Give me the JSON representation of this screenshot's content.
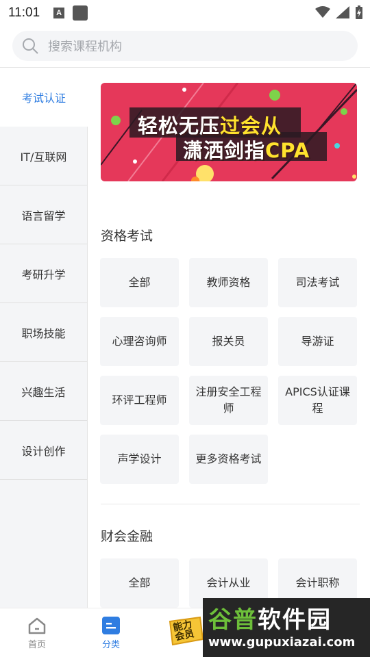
{
  "status_bar": {
    "time": "11:01",
    "notif_letter": "A"
  },
  "search": {
    "placeholder": "搜索课程机构"
  },
  "sidebar": {
    "items": [
      {
        "label": "考试认证",
        "active": true
      },
      {
        "label": "IT/互联网",
        "active": false
      },
      {
        "label": "语言留学",
        "active": false
      },
      {
        "label": "考研升学",
        "active": false
      },
      {
        "label": "职场技能",
        "active": false
      },
      {
        "label": "兴趣生活",
        "active": false
      },
      {
        "label": "设计创作",
        "active": false
      }
    ]
  },
  "banner": {
    "line1_a": "轻松无压",
    "line1_b": "过会从",
    "line2_a": "潇洒剑指",
    "line2_b": "CPA"
  },
  "sections": [
    {
      "title": "资格考试",
      "items": [
        "全部",
        "教师资格",
        "司法考试",
        "心理咨询师",
        "报关员",
        "导游证",
        "环评工程师",
        "注册安全工程师",
        "APICS认证课程",
        "声学设计",
        "更多资格考试"
      ]
    },
    {
      "title": "财会金融",
      "items": [
        "全部",
        "会计从业",
        "会计职称"
      ]
    }
  ],
  "bottom_nav": {
    "home": "首页",
    "category": "分类",
    "member_line1": "能力",
    "member_line2": "会员"
  },
  "watermark": {
    "main_a": "谷普",
    "main_b": "软件园",
    "url": "www.gupuxiazai.com"
  },
  "colors": {
    "accent": "#2f7de1",
    "banner_bg": "#e5385a",
    "chip_bg": "#f4f5f7"
  }
}
